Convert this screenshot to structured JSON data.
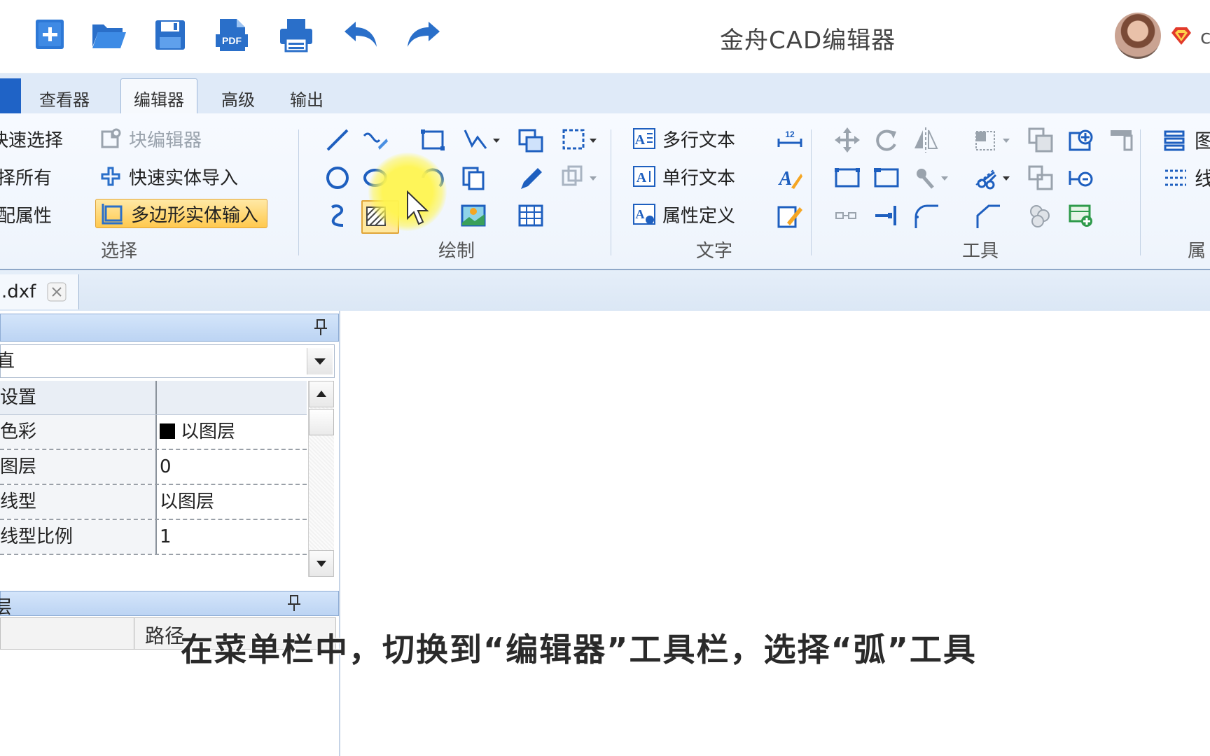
{
  "app": {
    "title": "金舟CAD编辑器",
    "user_initial": "c"
  },
  "quick_access": [
    {
      "name": "new-file-icon"
    },
    {
      "name": "open-folder-icon"
    },
    {
      "name": "save-icon"
    },
    {
      "name": "pdf-icon",
      "label": "PDF"
    },
    {
      "name": "print-icon"
    },
    {
      "name": "undo-icon"
    },
    {
      "name": "redo-icon"
    }
  ],
  "ribbon": {
    "tabs": [
      {
        "label": "查看器",
        "active": false
      },
      {
        "label": "编辑器",
        "active": true
      },
      {
        "label": "高级",
        "active": false
      },
      {
        "label": "输出",
        "active": false
      }
    ],
    "groups": {
      "select": {
        "label": "选择",
        "items": [
          "快速选择",
          "选择所有",
          "匹配属性"
        ],
        "items_visible": [
          "快速选择",
          "择所有",
          "配属性"
        ],
        "block_editor": "块编辑器",
        "quick_import": "快速实体导入",
        "polygon_input": "多边形实体输入"
      },
      "draw": {
        "label": "绘制"
      },
      "text": {
        "label": "文字",
        "multiline": "多行文本",
        "single": "单行文本",
        "attribute": "属性定义"
      },
      "tools": {
        "label": "工具"
      },
      "properties": {
        "label": "属"
      }
    },
    "right_edge_items": [
      "图",
      "线"
    ]
  },
  "document": {
    "tab_name": ".dxf"
  },
  "properties_panel": {
    "combo_value": "直",
    "rows": [
      {
        "name": "常规设置",
        "value": ""
      },
      {
        "name": "色彩",
        "value": "以图层",
        "swatch": "#000000"
      },
      {
        "name": "图层",
        "value": "0"
      },
      {
        "name": "线型",
        "value": "以图层"
      },
      {
        "name": "线型比例",
        "value": "1"
      }
    ],
    "rows_visible_names": [
      "设置",
      "色彩",
      "图层",
      "线型",
      "线型比例"
    ]
  },
  "layers_panel": {
    "title_visible": "层",
    "columns": [
      "",
      "路径"
    ]
  },
  "subtitle": "在菜单栏中，切换到“编辑器”工具栏，选择“弧”工具",
  "colors": {
    "accent": "#1f63c6",
    "ribbon_bg": "#eef4fc",
    "highlight": "#ffc94e"
  }
}
